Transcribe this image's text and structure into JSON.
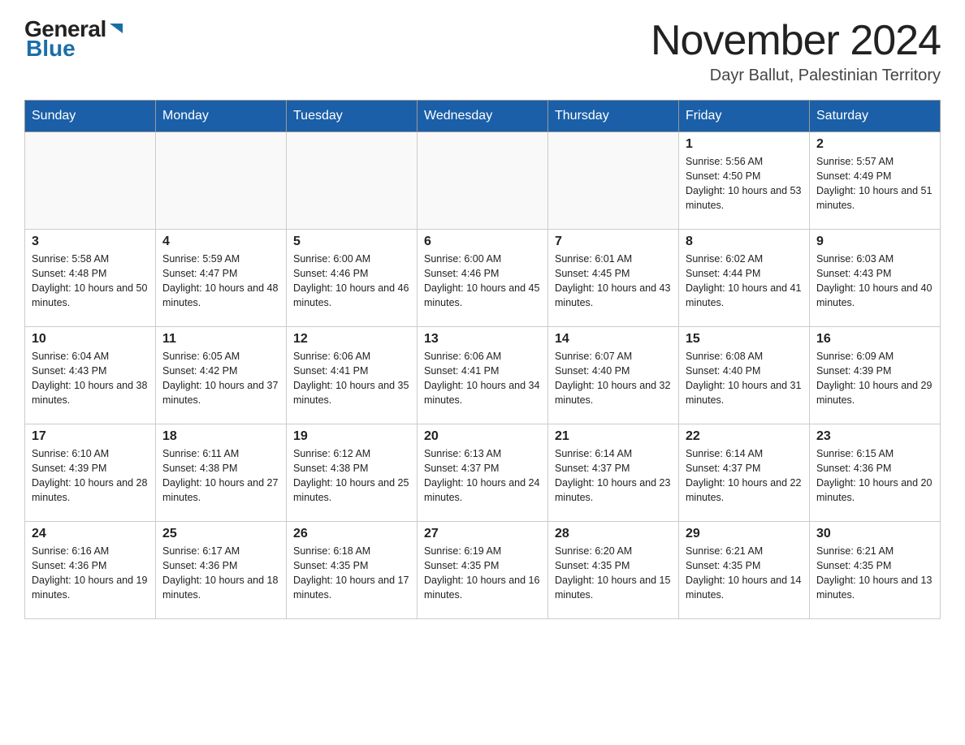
{
  "header": {
    "logo_general": "General",
    "logo_blue": "Blue",
    "month_title": "November 2024",
    "location": "Dayr Ballut, Palestinian Territory"
  },
  "days_of_week": [
    "Sunday",
    "Monday",
    "Tuesday",
    "Wednesday",
    "Thursday",
    "Friday",
    "Saturday"
  ],
  "weeks": [
    [
      {
        "day": "",
        "info": ""
      },
      {
        "day": "",
        "info": ""
      },
      {
        "day": "",
        "info": ""
      },
      {
        "day": "",
        "info": ""
      },
      {
        "day": "",
        "info": ""
      },
      {
        "day": "1",
        "info": "Sunrise: 5:56 AM\nSunset: 4:50 PM\nDaylight: 10 hours and 53 minutes."
      },
      {
        "day": "2",
        "info": "Sunrise: 5:57 AM\nSunset: 4:49 PM\nDaylight: 10 hours and 51 minutes."
      }
    ],
    [
      {
        "day": "3",
        "info": "Sunrise: 5:58 AM\nSunset: 4:48 PM\nDaylight: 10 hours and 50 minutes."
      },
      {
        "day": "4",
        "info": "Sunrise: 5:59 AM\nSunset: 4:47 PM\nDaylight: 10 hours and 48 minutes."
      },
      {
        "day": "5",
        "info": "Sunrise: 6:00 AM\nSunset: 4:46 PM\nDaylight: 10 hours and 46 minutes."
      },
      {
        "day": "6",
        "info": "Sunrise: 6:00 AM\nSunset: 4:46 PM\nDaylight: 10 hours and 45 minutes."
      },
      {
        "day": "7",
        "info": "Sunrise: 6:01 AM\nSunset: 4:45 PM\nDaylight: 10 hours and 43 minutes."
      },
      {
        "day": "8",
        "info": "Sunrise: 6:02 AM\nSunset: 4:44 PM\nDaylight: 10 hours and 41 minutes."
      },
      {
        "day": "9",
        "info": "Sunrise: 6:03 AM\nSunset: 4:43 PM\nDaylight: 10 hours and 40 minutes."
      }
    ],
    [
      {
        "day": "10",
        "info": "Sunrise: 6:04 AM\nSunset: 4:43 PM\nDaylight: 10 hours and 38 minutes."
      },
      {
        "day": "11",
        "info": "Sunrise: 6:05 AM\nSunset: 4:42 PM\nDaylight: 10 hours and 37 minutes."
      },
      {
        "day": "12",
        "info": "Sunrise: 6:06 AM\nSunset: 4:41 PM\nDaylight: 10 hours and 35 minutes."
      },
      {
        "day": "13",
        "info": "Sunrise: 6:06 AM\nSunset: 4:41 PM\nDaylight: 10 hours and 34 minutes."
      },
      {
        "day": "14",
        "info": "Sunrise: 6:07 AM\nSunset: 4:40 PM\nDaylight: 10 hours and 32 minutes."
      },
      {
        "day": "15",
        "info": "Sunrise: 6:08 AM\nSunset: 4:40 PM\nDaylight: 10 hours and 31 minutes."
      },
      {
        "day": "16",
        "info": "Sunrise: 6:09 AM\nSunset: 4:39 PM\nDaylight: 10 hours and 29 minutes."
      }
    ],
    [
      {
        "day": "17",
        "info": "Sunrise: 6:10 AM\nSunset: 4:39 PM\nDaylight: 10 hours and 28 minutes."
      },
      {
        "day": "18",
        "info": "Sunrise: 6:11 AM\nSunset: 4:38 PM\nDaylight: 10 hours and 27 minutes."
      },
      {
        "day": "19",
        "info": "Sunrise: 6:12 AM\nSunset: 4:38 PM\nDaylight: 10 hours and 25 minutes."
      },
      {
        "day": "20",
        "info": "Sunrise: 6:13 AM\nSunset: 4:37 PM\nDaylight: 10 hours and 24 minutes."
      },
      {
        "day": "21",
        "info": "Sunrise: 6:14 AM\nSunset: 4:37 PM\nDaylight: 10 hours and 23 minutes."
      },
      {
        "day": "22",
        "info": "Sunrise: 6:14 AM\nSunset: 4:37 PM\nDaylight: 10 hours and 22 minutes."
      },
      {
        "day": "23",
        "info": "Sunrise: 6:15 AM\nSunset: 4:36 PM\nDaylight: 10 hours and 20 minutes."
      }
    ],
    [
      {
        "day": "24",
        "info": "Sunrise: 6:16 AM\nSunset: 4:36 PM\nDaylight: 10 hours and 19 minutes."
      },
      {
        "day": "25",
        "info": "Sunrise: 6:17 AM\nSunset: 4:36 PM\nDaylight: 10 hours and 18 minutes."
      },
      {
        "day": "26",
        "info": "Sunrise: 6:18 AM\nSunset: 4:35 PM\nDaylight: 10 hours and 17 minutes."
      },
      {
        "day": "27",
        "info": "Sunrise: 6:19 AM\nSunset: 4:35 PM\nDaylight: 10 hours and 16 minutes."
      },
      {
        "day": "28",
        "info": "Sunrise: 6:20 AM\nSunset: 4:35 PM\nDaylight: 10 hours and 15 minutes."
      },
      {
        "day": "29",
        "info": "Sunrise: 6:21 AM\nSunset: 4:35 PM\nDaylight: 10 hours and 14 minutes."
      },
      {
        "day": "30",
        "info": "Sunrise: 6:21 AM\nSunset: 4:35 PM\nDaylight: 10 hours and 13 minutes."
      }
    ]
  ]
}
